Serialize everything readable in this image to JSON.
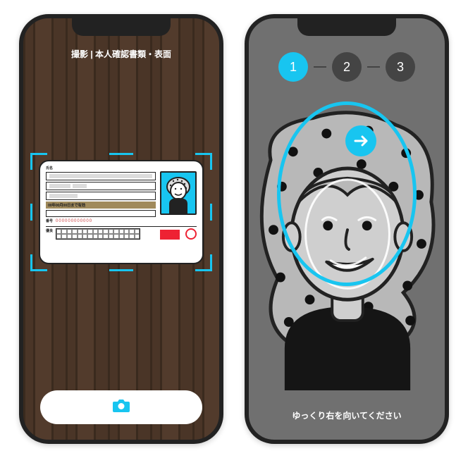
{
  "colors": {
    "accent": "#18c5f0",
    "phone_frame": "#222222",
    "phone2_bg": "#707070",
    "red": "#e23030"
  },
  "phone_doc": {
    "header": "撮影 | 本人確認書類・表面",
    "card": {
      "validity_text": "00年00月00日まで有効",
      "label_top": "氏名",
      "label_number": "番号",
      "number_placeholder": "000000000000",
      "label_bottom": "優良",
      "mark": "〇"
    },
    "shutter_icon": "camera-icon"
  },
  "phone_face": {
    "steps": [
      {
        "n": "1",
        "active": true
      },
      {
        "n": "2",
        "active": false
      },
      {
        "n": "3",
        "active": false
      }
    ],
    "arrow_icon": "arrow-right-icon",
    "instruction": "ゆっくり右を向いてください"
  }
}
